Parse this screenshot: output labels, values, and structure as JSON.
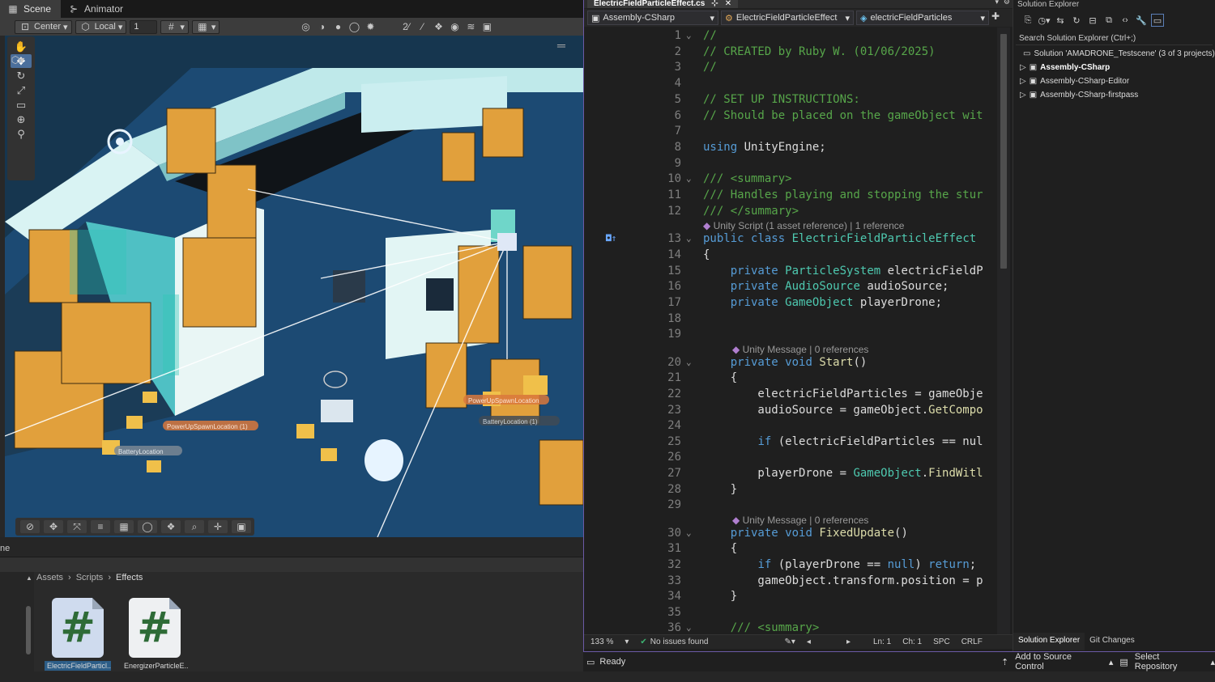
{
  "unity": {
    "tabs": [
      {
        "label": "Scene",
        "icon": "grid-icon"
      },
      {
        "label": "Animator",
        "icon": "animator-icon"
      }
    ],
    "toolbar": {
      "pivot": "Center",
      "space": "Local",
      "snap": "1"
    },
    "status_text": "ne",
    "project": {
      "breadcrumb": [
        "Assets",
        "Scripts",
        "Effects"
      ],
      "assets": [
        {
          "label": "ElectricFieldParticl..."
        },
        {
          "label": "EnergizerParticleE..."
        }
      ]
    },
    "scene_labels": [
      "PowerUpSpawnLocation (1)",
      "PowerUpSpawnLocation",
      "BatteryLocation",
      "BatteryLocation (1)"
    ]
  },
  "vs": {
    "tab": {
      "title": "ElectricFieldParticleEffect.cs"
    },
    "nav": {
      "project": "Assembly-CSharp",
      "class": "ElectricFieldParticleEffect",
      "member": "electricFieldParticles"
    },
    "lens": {
      "l1": "Unity Script (1 asset reference) | 1 reference",
      "l2": "Unity Message | 0 references",
      "l3": "Unity Message | 0 references"
    },
    "status": {
      "zoom": "133 %",
      "issues": "No issues found",
      "ln": "Ln: 1",
      "ch": "Ch: 1",
      "enc": "SPC",
      "eol": "CRLF"
    },
    "bottom": {
      "ready": "Ready",
      "source": "Add to Source Control",
      "repo": "Select Repository"
    }
  },
  "sol": {
    "title": "Solution Explorer",
    "search": "Search Solution Explorer (Ctrl+;)",
    "root": "Solution 'AMADRONE_Testscene' (3 of 3 projects)",
    "projects": [
      "Assembly-CSharp",
      "Assembly-CSharp-Editor",
      "Assembly-CSharp-firstpass"
    ],
    "tabs": [
      "Solution Explorer",
      "Git Changes"
    ]
  },
  "code_lines": [
    {
      "n": "1",
      "t": "//"
    },
    {
      "n": "2",
      "t": "// CREATED by Ruby W. (01/06/2025)"
    },
    {
      "n": "3",
      "t": "//"
    },
    {
      "n": "4",
      "t": ""
    },
    {
      "n": "5",
      "t": "// SET UP INSTRUCTIONS:"
    },
    {
      "n": "6",
      "t": "// Should be placed on the gameObject wit"
    },
    {
      "n": "7",
      "t": ""
    },
    {
      "n": "8",
      "t": "using UnityEngine;"
    },
    {
      "n": "9",
      "t": ""
    },
    {
      "n": "10",
      "t": "/// <summary>"
    },
    {
      "n": "11",
      "t": "/// Handles playing and stopping the stur"
    },
    {
      "n": "12",
      "t": "/// </summary>"
    },
    {
      "n": "13",
      "t": "public class ElectricFieldParticleEffect"
    },
    {
      "n": "14",
      "t": "{"
    },
    {
      "n": "15",
      "t": "    private ParticleSystem electricFieldP"
    },
    {
      "n": "16",
      "t": "    private AudioSource audioSource;"
    },
    {
      "n": "17",
      "t": "    private GameObject playerDrone;"
    },
    {
      "n": "18",
      "t": ""
    },
    {
      "n": "19",
      "t": ""
    },
    {
      "n": "20",
      "t": "    private void Start()"
    },
    {
      "n": "21",
      "t": "    {"
    },
    {
      "n": "22",
      "t": "        electricFieldParticles = gameObje"
    },
    {
      "n": "23",
      "t": "        audioSource = gameObject.GetCompo"
    },
    {
      "n": "24",
      "t": ""
    },
    {
      "n": "25",
      "t": "        if (electricFieldParticles == nul"
    },
    {
      "n": "26",
      "t": ""
    },
    {
      "n": "27",
      "t": "        playerDrone = GameObject.FindWitl"
    },
    {
      "n": "28",
      "t": "    }"
    },
    {
      "n": "29",
      "t": ""
    },
    {
      "n": "30",
      "t": "    private void FixedUpdate()"
    },
    {
      "n": "31",
      "t": "    {"
    },
    {
      "n": "32",
      "t": "        if (playerDrone == null) return;"
    },
    {
      "n": "33",
      "t": "        gameObject.transform.position = p"
    },
    {
      "n": "34",
      "t": "    }"
    },
    {
      "n": "35",
      "t": ""
    },
    {
      "n": "36",
      "t": "    /// <summary>"
    }
  ]
}
